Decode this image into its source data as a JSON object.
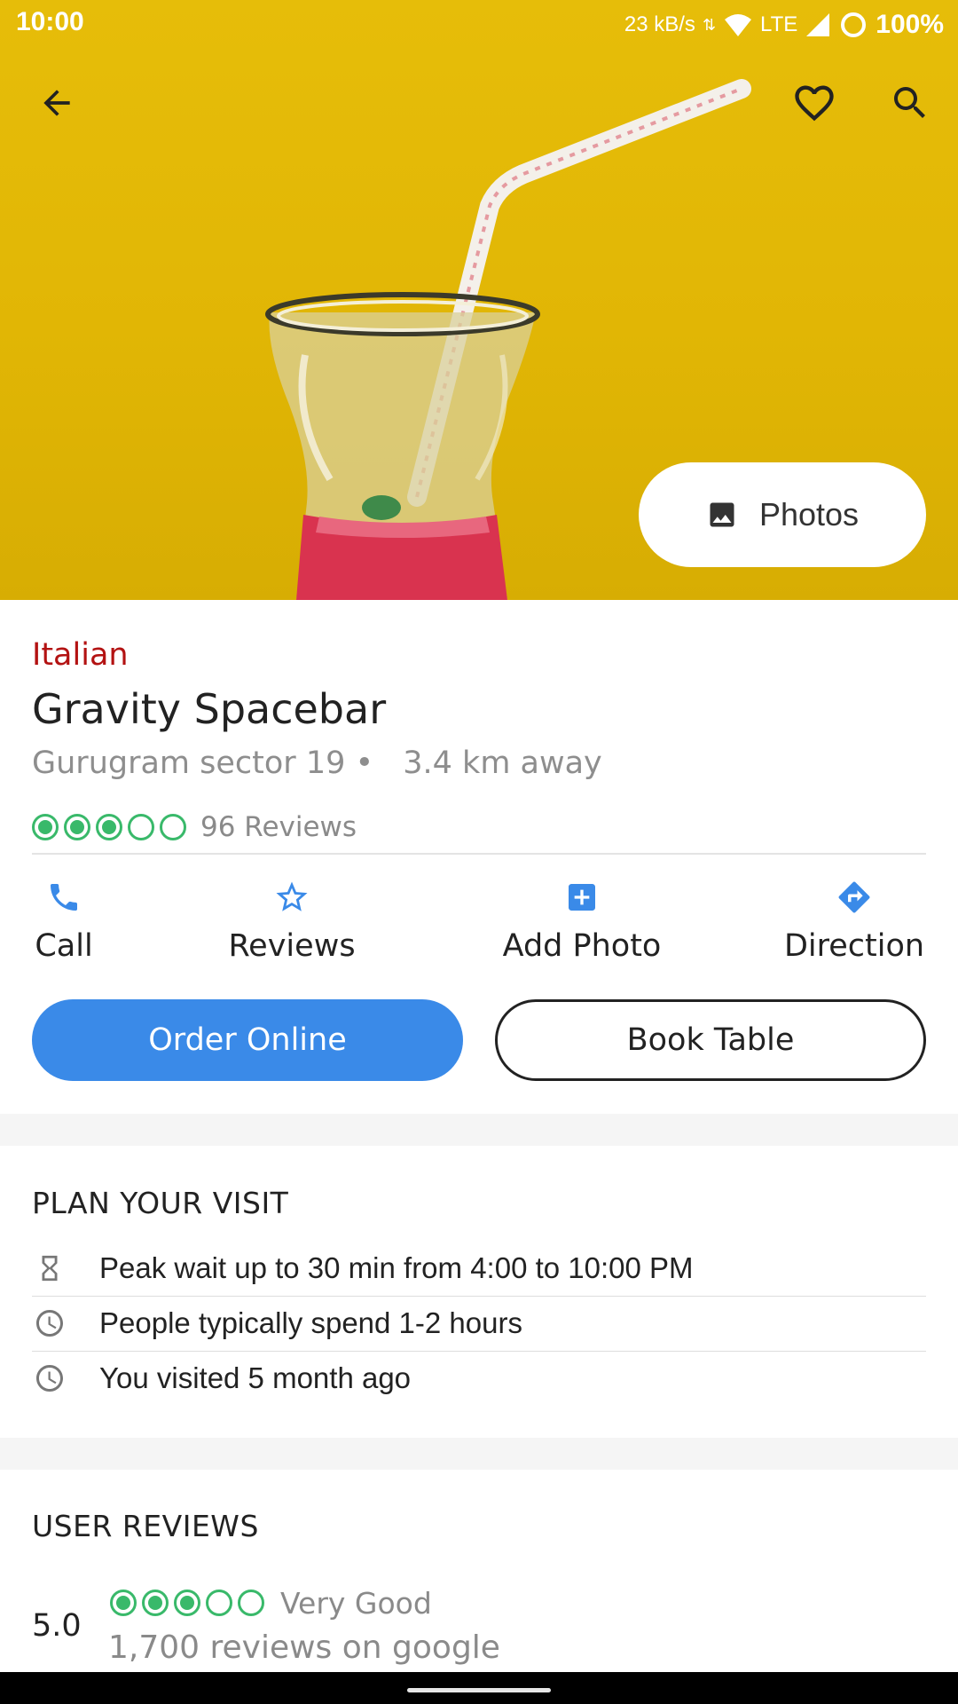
{
  "status_bar": {
    "time": "10:00",
    "net_speed": "23 kB/s",
    "network": "LTE",
    "battery": "100%"
  },
  "header": {
    "back_icon": "arrow-left-icon",
    "favorite_icon": "heart-outline-icon",
    "search_icon": "search-icon",
    "photos_label": "Photos"
  },
  "restaurant": {
    "cuisine": "Italian",
    "name": "Gravity Spacebar",
    "location": "Gurugram sector 19 •",
    "distance": "3.4 km away",
    "rating_filled": 3,
    "rating_total": 5,
    "reviews_text": "96 Reviews"
  },
  "actions": [
    {
      "label": "Call",
      "icon": "phone-icon"
    },
    {
      "label": "Reviews",
      "icon": "star-outline-icon"
    },
    {
      "label": "Add Photo",
      "icon": "add-box-icon"
    },
    {
      "label": "Direction",
      "icon": "direction-icon"
    }
  ],
  "buttons": {
    "order_online": "Order Online",
    "book_table": "Book Table"
  },
  "plan_visit": {
    "title": "PLAN YOUR VISIT",
    "rows": [
      {
        "icon": "hourglass-icon",
        "text": "Peak wait up to 30 min from 4:00 to 10:00 PM"
      },
      {
        "icon": "clock-icon",
        "text": "People typically spend 1-2 hours"
      },
      {
        "icon": "clock-icon",
        "text": "You visited 5 month ago"
      }
    ]
  },
  "user_reviews": {
    "title": "USER REVIEWS",
    "score": "5.0",
    "rating_filled": 3,
    "rating_total": 5,
    "rating_label": "Very Good",
    "count_text": "1,700 reviews on google"
  },
  "colors": {
    "accent": "#3a8ae8",
    "cuisine": "#b31212",
    "rating": "#39b96a",
    "hero": "#e2b807"
  }
}
